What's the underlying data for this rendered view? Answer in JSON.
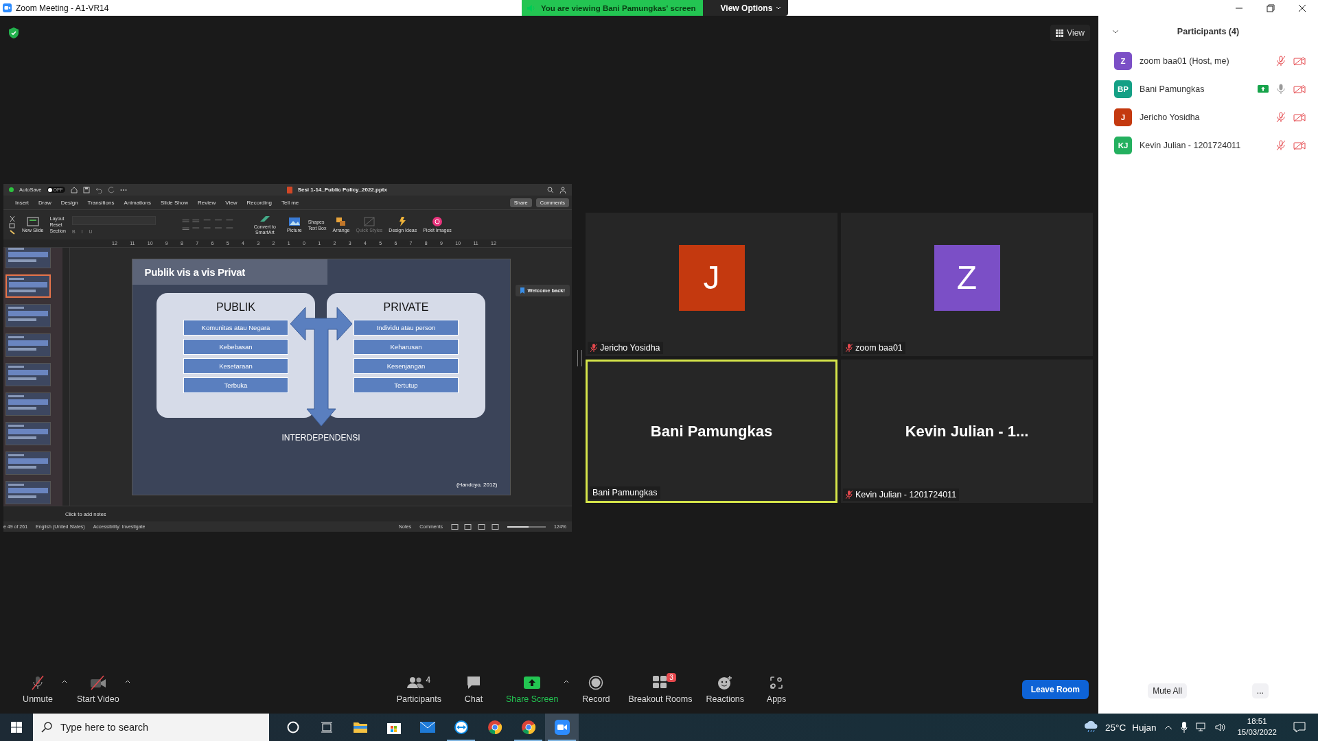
{
  "window": {
    "title": "Zoom Meeting - A1-VR14"
  },
  "banner": {
    "text": "You are viewing Bani Pamungkas' screen",
    "options": "View Options"
  },
  "view_button": {
    "label": "View"
  },
  "shared_screen": {
    "app_title": "Sesi 1-14_Public Policy_2022.pptx",
    "autosave": {
      "label": "AutoSave",
      "on": false,
      "state_text": "OFF"
    },
    "tabs": [
      "Insert",
      "Draw",
      "Design",
      "Transitions",
      "Animations",
      "Slide Show",
      "Review",
      "View",
      "Recording",
      "Tell me"
    ],
    "share": "Share",
    "comments": "Comments",
    "ribbon": {
      "new_slide": "New Slide",
      "layout": "Layout",
      "reset": "Reset",
      "section": "Section",
      "format": [
        "B",
        "I",
        "U"
      ],
      "convert": "Convert to SmartArt",
      "picture": "Picture",
      "shapes": "Shapes",
      "text_box": "Text Box",
      "arrange": "Arrange",
      "quick_styles": "Quick Styles",
      "design_ideas": "Design Ideas",
      "pickit": "Pickit Images"
    },
    "ruler": [
      "12",
      "11",
      "10",
      "9",
      "8",
      "7",
      "6",
      "5",
      "4",
      "3",
      "2",
      "1",
      "0",
      "1",
      "2",
      "3",
      "4",
      "5",
      "6",
      "7",
      "8",
      "9",
      "10",
      "11",
      "12"
    ],
    "thumbnails": [
      {
        "selected": false
      },
      {
        "selected": true
      },
      {
        "selected": false
      },
      {
        "selected": false
      },
      {
        "selected": false
      },
      {
        "selected": false
      },
      {
        "selected": false
      },
      {
        "selected": false
      },
      {
        "selected": false
      }
    ],
    "slide": {
      "title": "Publik vis a vis Privat",
      "panels": [
        {
          "heading": "PUBLIK",
          "items": [
            "Komunitas atau Negara",
            "Kebebasan",
            "Kesetaraan",
            "Terbuka"
          ]
        },
        {
          "heading": "PRIVATE",
          "items": [
            "Individu atau person",
            "Keharusan",
            "Kesenjangan",
            "Tertutup"
          ]
        }
      ],
      "footer": "INTERDEPENDENSI",
      "citation": "(Handoyo, 2012)"
    },
    "tooltip": "Welcome back!",
    "notes_placeholder": "Click to add notes",
    "status": {
      "slide": "e 49 of 261",
      "language": "English (United States)",
      "accessibility": "Accessibility: Investigate",
      "notes": "Notes",
      "comments": "Comments",
      "zoom": {
        "level": 0.55
      },
      "zoom_text": "124%"
    }
  },
  "tiles": [
    {
      "kind": "avatar",
      "avatar": "J",
      "color": "#c4390f",
      "name": "Jericho Yosidha",
      "muted": true,
      "active": false
    },
    {
      "kind": "avatar",
      "avatar": "Z",
      "color": "#7b4fc6",
      "name": "zoom baa01",
      "muted": true,
      "active": false
    },
    {
      "kind": "name",
      "display": "Bani Pamungkas",
      "name": "Bani Pamungkas",
      "muted": false,
      "active": true
    },
    {
      "kind": "name",
      "display": "Kevin Julian - 1...",
      "name": "Kevin Julian - 1201724011",
      "muted": true,
      "active": false
    }
  ],
  "participants": {
    "title": "Participants (4)",
    "items": [
      {
        "initials": "Z",
        "color": "#7b4fc6",
        "name": "zoom baa01 (Host, me)",
        "sharing": false,
        "muted": true,
        "video_off": true
      },
      {
        "initials": "BP",
        "color": "#14a085",
        "name": "Bani Pamungkas",
        "sharing": true,
        "muted": false,
        "video_off": true
      },
      {
        "initials": "J",
        "color": "#c4390f",
        "name": "Jericho Yosidha",
        "sharing": false,
        "muted": true,
        "video_off": true
      },
      {
        "initials": "KJ",
        "color": "#24b05f",
        "name": "Kevin Julian - 1201724011",
        "sharing": false,
        "muted": true,
        "video_off": true
      }
    ],
    "mute_all": "Mute All",
    "more": "..."
  },
  "toolbar": {
    "left": [
      {
        "kind": "audio",
        "label": "Unmute",
        "muted": true,
        "caret": true
      },
      {
        "kind": "video",
        "label": "Start Video",
        "muted": true,
        "caret": true
      }
    ],
    "center": [
      {
        "kind": "participants",
        "label": "Participants",
        "count": "4",
        "caret": false
      },
      {
        "kind": "chat",
        "label": "Chat",
        "caret": false
      },
      {
        "kind": "share",
        "label": "Share Screen",
        "caret": true
      },
      {
        "kind": "record",
        "label": "Record",
        "caret": false
      },
      {
        "kind": "breakout",
        "label": "Breakout Rooms",
        "badge": "3",
        "caret": false
      },
      {
        "kind": "reactions",
        "label": "Reactions",
        "caret": false
      },
      {
        "kind": "apps",
        "label": "Apps",
        "caret": false
      }
    ],
    "leave": "Leave Room"
  },
  "taskbar": {
    "search_placeholder": "Type here to search",
    "apps": [
      {
        "kind": "cortana",
        "running": false,
        "selected": false
      },
      {
        "kind": "taskview",
        "running": false,
        "selected": false
      },
      {
        "kind": "explorer",
        "running": false,
        "selected": false
      },
      {
        "kind": "store",
        "running": false,
        "selected": false
      },
      {
        "kind": "mail",
        "running": false,
        "selected": false
      },
      {
        "kind": "teamviewer",
        "running": true,
        "selected": false
      },
      {
        "kind": "chrome",
        "running": false,
        "selected": false
      },
      {
        "kind": "chrome",
        "running": true,
        "selected": false
      },
      {
        "kind": "zoom",
        "running": true,
        "selected": true
      }
    ],
    "weather": {
      "temp": "25°C",
      "condition": "Hujan"
    },
    "time": "18:51",
    "date": "15/03/2022"
  }
}
